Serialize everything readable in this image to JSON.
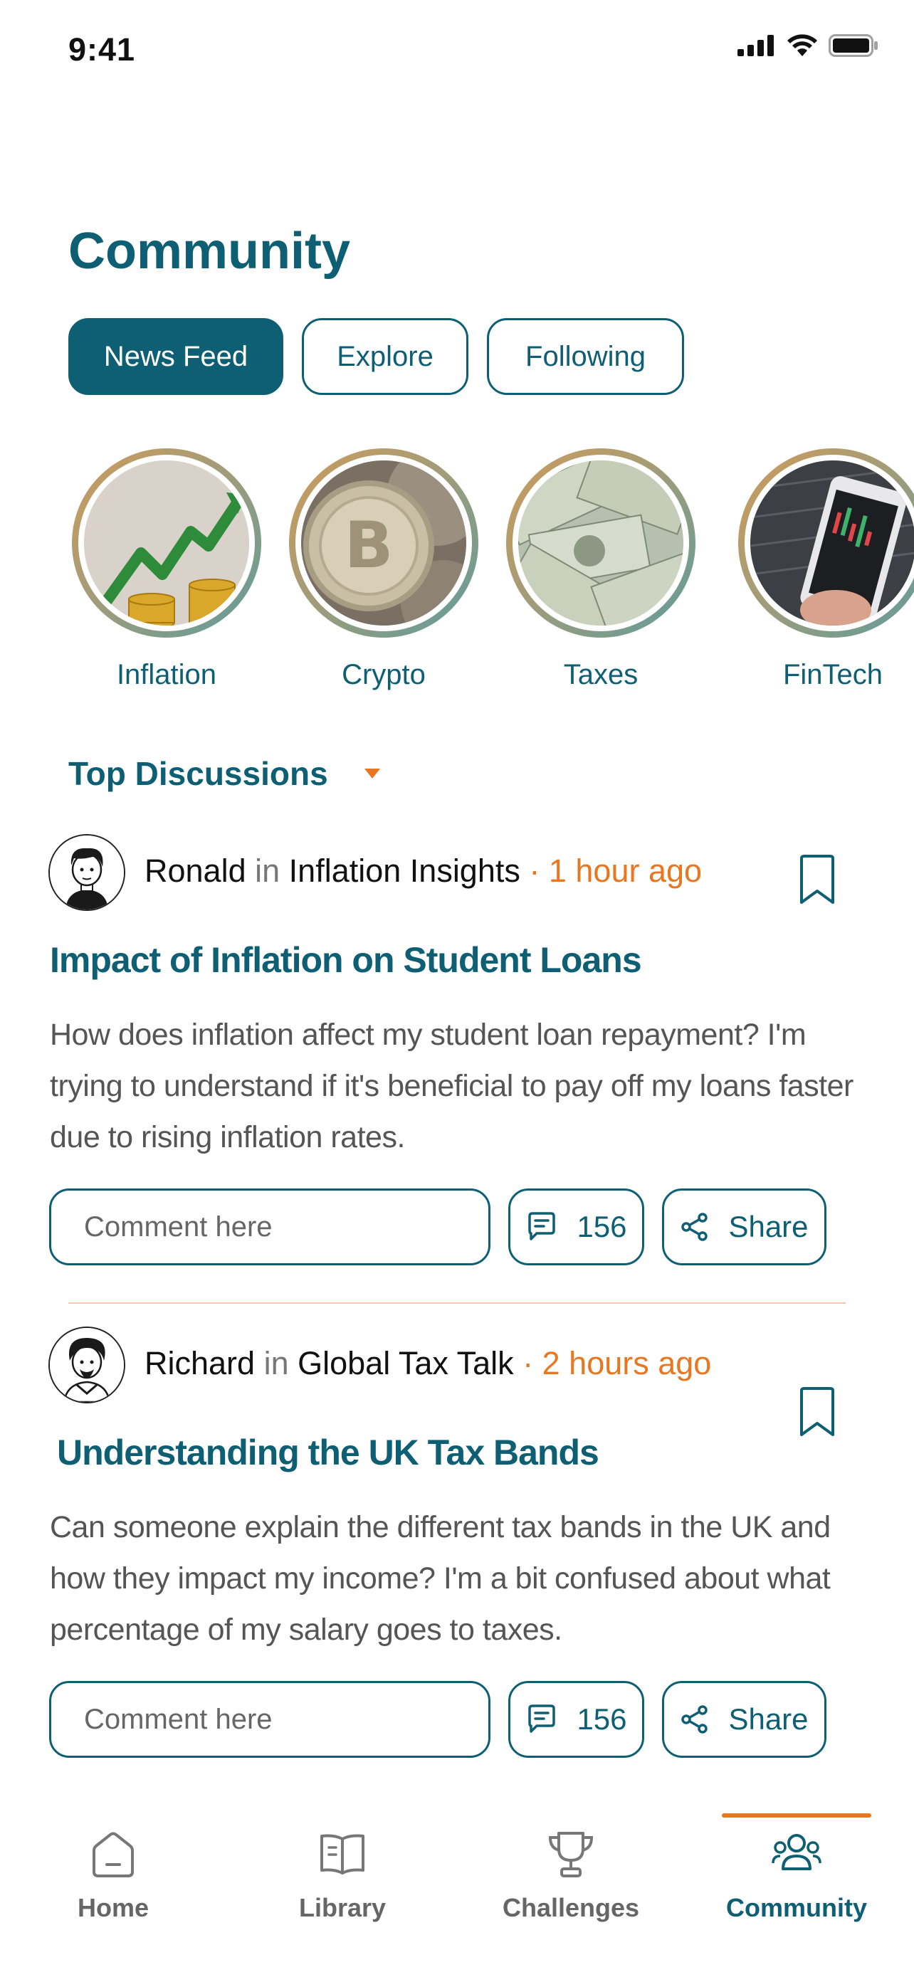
{
  "status_bar": {
    "time": "9:41"
  },
  "page": {
    "title": "Community"
  },
  "tabs": [
    {
      "label": "News Feed",
      "active": true
    },
    {
      "label": "Explore",
      "active": false
    },
    {
      "label": "Following",
      "active": false
    }
  ],
  "topics": [
    {
      "label": "Inflation",
      "image": "inflation-chart-coins"
    },
    {
      "label": "Crypto",
      "image": "bitcoin-coins"
    },
    {
      "label": "Taxes",
      "image": "dollar-bills"
    },
    {
      "label": "FinTech",
      "image": "phone-trading-app"
    }
  ],
  "section": {
    "title": "Top Discussions"
  },
  "posts": [
    {
      "author": "Ronald",
      "in_label": "in",
      "group": "Inflation Insights",
      "time": "· 1 hour ago",
      "title": "Impact of Inflation on Student Loans",
      "body": "How does inflation affect my student loan repayment? I'm trying to understand if it's beneficial to pay off my loans faster due to rising inflation rates.",
      "comment_placeholder": "Comment here",
      "comment_count": "156",
      "share_label": "Share"
    },
    {
      "author": "Richard",
      "in_label": "in",
      "group": "Global Tax Talk",
      "time": "· 2 hours ago",
      "title": "Understanding the UK Tax Bands",
      "body": "Can someone explain the different tax bands in the UK and how they impact my income? I'm a bit confused about what percentage of my salary goes to taxes.",
      "comment_placeholder": "Comment here",
      "comment_count": "156",
      "share_label": "Share"
    }
  ],
  "bottom_nav": [
    {
      "label": "Home",
      "icon": "home-icon",
      "active": false
    },
    {
      "label": "Library",
      "icon": "book-icon",
      "active": false
    },
    {
      "label": "Challenges",
      "icon": "trophy-icon",
      "active": false
    },
    {
      "label": "Community",
      "icon": "people-icon",
      "active": true
    }
  ],
  "colors": {
    "primary": "#0e5f73",
    "accent": "#e87722",
    "divider": "#f3c9a4"
  }
}
